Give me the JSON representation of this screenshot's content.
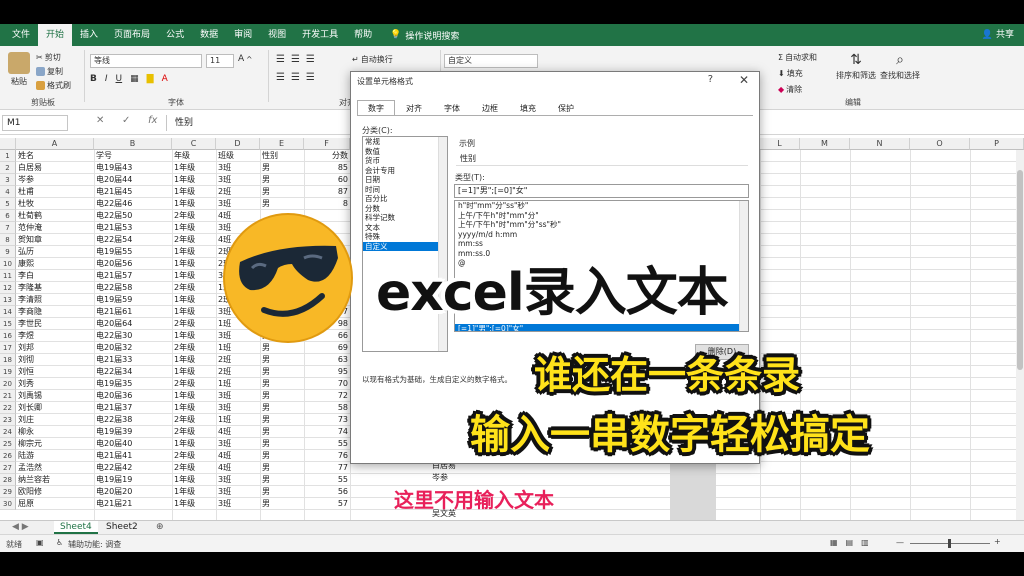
{
  "ribbon_tabs": [
    "文件",
    "开始",
    "插入",
    "页面布局",
    "公式",
    "数据",
    "审阅",
    "视图",
    "开发工具",
    "帮助"
  ],
  "tell_me": "操作说明搜索",
  "share": "共享",
  "ribbon": {
    "clipboard": {
      "paste": "粘贴",
      "cut": "剪切",
      "copy": "复制",
      "format_painter": "格式刷",
      "label": "剪贴板"
    },
    "font": {
      "name": "等线",
      "size": "11",
      "label": "字体"
    },
    "alignment": {
      "wrap": "自动换行",
      "label": "对齐方式"
    },
    "number": {
      "format": "自定义"
    },
    "editing": {
      "autosum": "自动求和",
      "fill": "填充",
      "clear": "清除",
      "sort": "排序和筛选",
      "find": "查找和选择",
      "label": "编辑"
    }
  },
  "formula_bar": {
    "name_box": "M1",
    "fx": "fx",
    "value": "性别"
  },
  "columns": [
    "A",
    "B",
    "C",
    "D",
    "E",
    "F",
    "",
    "",
    "",
    "",
    "",
    "",
    "",
    "",
    "",
    "",
    "",
    "",
    "",
    "",
    "",
    "L",
    "M",
    "N",
    "O",
    "P"
  ],
  "headers": [
    "姓名",
    "学号",
    "年级",
    "班级",
    "性别",
    "分数"
  ],
  "rows": [
    [
      "白居易",
      "电19届43",
      "1年级",
      "3班",
      "男",
      "85"
    ],
    [
      "岑参",
      "电20届44",
      "1年级",
      "3班",
      "男",
      "60"
    ],
    [
      "杜甫",
      "电21届45",
      "1年级",
      "2班",
      "男",
      "87"
    ],
    [
      "杜牧",
      "电22届46",
      "1年级",
      "3班",
      "男",
      "8"
    ],
    [
      "杜荀鹤",
      "电22届50",
      "2年级",
      "4班",
      "",
      ""
    ],
    [
      "范仲淹",
      "电21届53",
      "1年级",
      "3班",
      "",
      ""
    ],
    [
      "贺知章",
      "电22届54",
      "2年级",
      "4班",
      "",
      ""
    ],
    [
      "弘历",
      "电19届55",
      "1年级",
      "2班",
      "",
      ""
    ],
    [
      "康熙",
      "电20届56",
      "1年级",
      "2班",
      "",
      ""
    ],
    [
      "李白",
      "电21届57",
      "1年级",
      "3班",
      "",
      ""
    ],
    [
      "李隆基",
      "电22届58",
      "2年级",
      "1班",
      "",
      ""
    ],
    [
      "李清照",
      "电19届59",
      "1年级",
      "2班",
      "",
      ""
    ],
    [
      "李商隐",
      "电21届61",
      "1年级",
      "3班",
      "",
      "97"
    ],
    [
      "李世民",
      "电20届64",
      "2年级",
      "1班",
      "",
      "98"
    ],
    [
      "李煜",
      "电22届30",
      "1年级",
      "3班",
      "男",
      "66"
    ],
    [
      "刘邦",
      "电20届32",
      "2年级",
      "1班",
      "男",
      "69"
    ],
    [
      "刘彻",
      "电21届33",
      "1年级",
      "2班",
      "男",
      "63"
    ],
    [
      "刘恒",
      "电22届34",
      "1年级",
      "2班",
      "男",
      "95"
    ],
    [
      "刘秀",
      "电19届35",
      "2年级",
      "1班",
      "男",
      "70"
    ],
    [
      "刘禹锡",
      "电20届36",
      "1年级",
      "3班",
      "男",
      "72"
    ],
    [
      "刘长卿",
      "电21届37",
      "1年级",
      "3班",
      "男",
      "58"
    ],
    [
      "刘庄",
      "电22届38",
      "2年级",
      "1班",
      "男",
      "73"
    ],
    [
      "柳永",
      "电19届39",
      "2年级",
      "4班",
      "男",
      "74"
    ],
    [
      "柳宗元",
      "电20届40",
      "1年级",
      "3班",
      "男",
      "55"
    ],
    [
      "陆游",
      "电21届41",
      "2年级",
      "4班",
      "男",
      "76"
    ],
    [
      "孟浩然",
      "电22届42",
      "2年级",
      "4班",
      "男",
      "77"
    ],
    [
      "纳兰容若",
      "电19届19",
      "1年级",
      "3班",
      "男",
      "55"
    ],
    [
      "欧阳修",
      "电20届20",
      "1年级",
      "3班",
      "男",
      "56"
    ],
    [
      "屈原",
      "电21届21",
      "1年级",
      "3班",
      "男",
      "57"
    ]
  ],
  "row_numbers": [
    "1",
    "2",
    "3",
    "4",
    "5",
    "6",
    "7",
    "8",
    "9",
    "10",
    "11",
    "12",
    "13",
    "14",
    "15",
    "16",
    "17",
    "18",
    "19",
    "20",
    "21",
    "22",
    "23",
    "24",
    "25",
    "26",
    "27",
    "28",
    "29",
    "30"
  ],
  "col_k_values": [
    "白居易",
    "岑参",
    "",
    "吴文英"
  ],
  "sheets": [
    "Sheet4",
    "Sheet2"
  ],
  "status": {
    "ready": "就绪",
    "accessibility": "辅助功能: 调查"
  },
  "zoom_minus": "—",
  "zoom_plus": "+",
  "dialog": {
    "title": "设置单元格格式",
    "tabs": [
      "数字",
      "对齐",
      "字体",
      "边框",
      "填充",
      "保护"
    ],
    "category_label": "分类(C):",
    "categories": [
      "常规",
      "数值",
      "货币",
      "会计专用",
      "日期",
      "时间",
      "百分比",
      "分数",
      "科学记数",
      "文本",
      "特殊",
      "自定义"
    ],
    "selected_category": "自定义",
    "sample_label": "示例",
    "sample_value": "性别",
    "type_label": "类型(T):",
    "type_value": "[=1]\"男\";[=0]\"女\"",
    "formats": [
      "h\"时\"mm\"分\"ss\"秒\"",
      "上午/下午h\"时\"mm\"分\"",
      "上午/下午h\"时\"mm\"分\"ss\"秒\"",
      "yyyy/m/d h:mm",
      "mm:ss",
      "mm:ss.0",
      "@",
      "",
      "",
      "",
      "",
      "",
      "[=1]\"男\";[=0]\"女\""
    ],
    "delete_button": "删除(D)",
    "note": "以现有格式为基础，生成自定义的数字格式。"
  },
  "overlay": {
    "title": "excel录入文本",
    "line1": "谁还在一条条录",
    "line2": "输入一串数字轻松搞定",
    "note": "这里不用输入文本"
  },
  "colors": {
    "excel_green": "#217346",
    "selection_blue": "#0078d7",
    "yellow_text": "#ffe21a",
    "pink_text": "#e8205a"
  }
}
